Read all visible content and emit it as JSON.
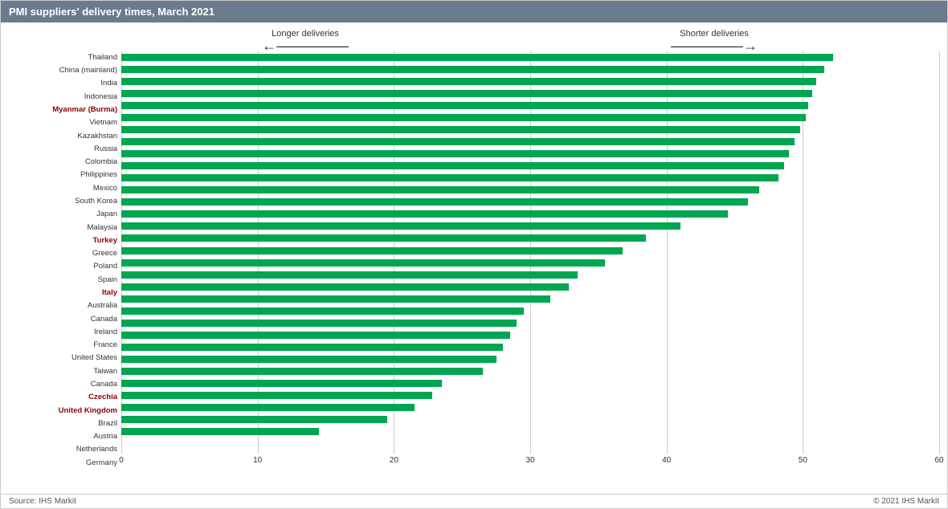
{
  "title": "PMI suppliers' delivery times, March 2021",
  "annotations": {
    "longer": "Longer deliveries",
    "shorter": "Shorter deliveries"
  },
  "footer": {
    "source": "Source:  IHS Markit",
    "copyright": "© 2021 IHS Markit"
  },
  "xAxis": {
    "min": 0,
    "max": 60,
    "ticks": [
      0,
      10,
      20,
      30,
      40,
      50,
      60
    ]
  },
  "countries": [
    {
      "name": "Thailand",
      "value": 52.2,
      "highlight": false
    },
    {
      "name": "China (mainland)",
      "value": 51.6,
      "highlight": false
    },
    {
      "name": "India",
      "value": 51.0,
      "highlight": false
    },
    {
      "name": "Indonesia",
      "value": 50.7,
      "highlight": false
    },
    {
      "name": "Myanmar (Burma)",
      "value": 50.4,
      "highlight": true
    },
    {
      "name": "Vietnam",
      "value": 50.2,
      "highlight": false
    },
    {
      "name": "Kazakhstan",
      "value": 49.8,
      "highlight": false
    },
    {
      "name": "Russia",
      "value": 49.4,
      "highlight": false
    },
    {
      "name": "Colombia",
      "value": 49.0,
      "highlight": false
    },
    {
      "name": "Philippines",
      "value": 48.6,
      "highlight": false
    },
    {
      "name": "Mexico",
      "value": 48.2,
      "highlight": false
    },
    {
      "name": "South Korea",
      "value": 46.8,
      "highlight": false
    },
    {
      "name": "Japan",
      "value": 46.0,
      "highlight": false
    },
    {
      "name": "Malaysia",
      "value": 44.5,
      "highlight": false
    },
    {
      "name": "Turkey",
      "value": 41.0,
      "highlight": true
    },
    {
      "name": "Greece",
      "value": 38.5,
      "highlight": false
    },
    {
      "name": "Poland",
      "value": 36.8,
      "highlight": false
    },
    {
      "name": "Spain",
      "value": 35.5,
      "highlight": false
    },
    {
      "name": "Italy",
      "value": 33.5,
      "highlight": true
    },
    {
      "name": "Australia",
      "value": 32.8,
      "highlight": false
    },
    {
      "name": "Canada",
      "value": 31.5,
      "highlight": false
    },
    {
      "name": "Ireland",
      "value": 29.5,
      "highlight": false
    },
    {
      "name": "France",
      "value": 29.0,
      "highlight": false
    },
    {
      "name": "United States",
      "value": 28.5,
      "highlight": false
    },
    {
      "name": "Taiwan",
      "value": 28.0,
      "highlight": false
    },
    {
      "name": "Canada",
      "value": 27.5,
      "highlight": false
    },
    {
      "name": "Czechia",
      "value": 26.5,
      "highlight": true
    },
    {
      "name": "United Kingdom",
      "value": 23.5,
      "highlight": true
    },
    {
      "name": "Brazil",
      "value": 22.8,
      "highlight": false
    },
    {
      "name": "Austria",
      "value": 21.5,
      "highlight": false
    },
    {
      "name": "Netherlands",
      "value": 19.5,
      "highlight": false
    },
    {
      "name": "Germany",
      "value": 14.5,
      "highlight": false
    }
  ]
}
